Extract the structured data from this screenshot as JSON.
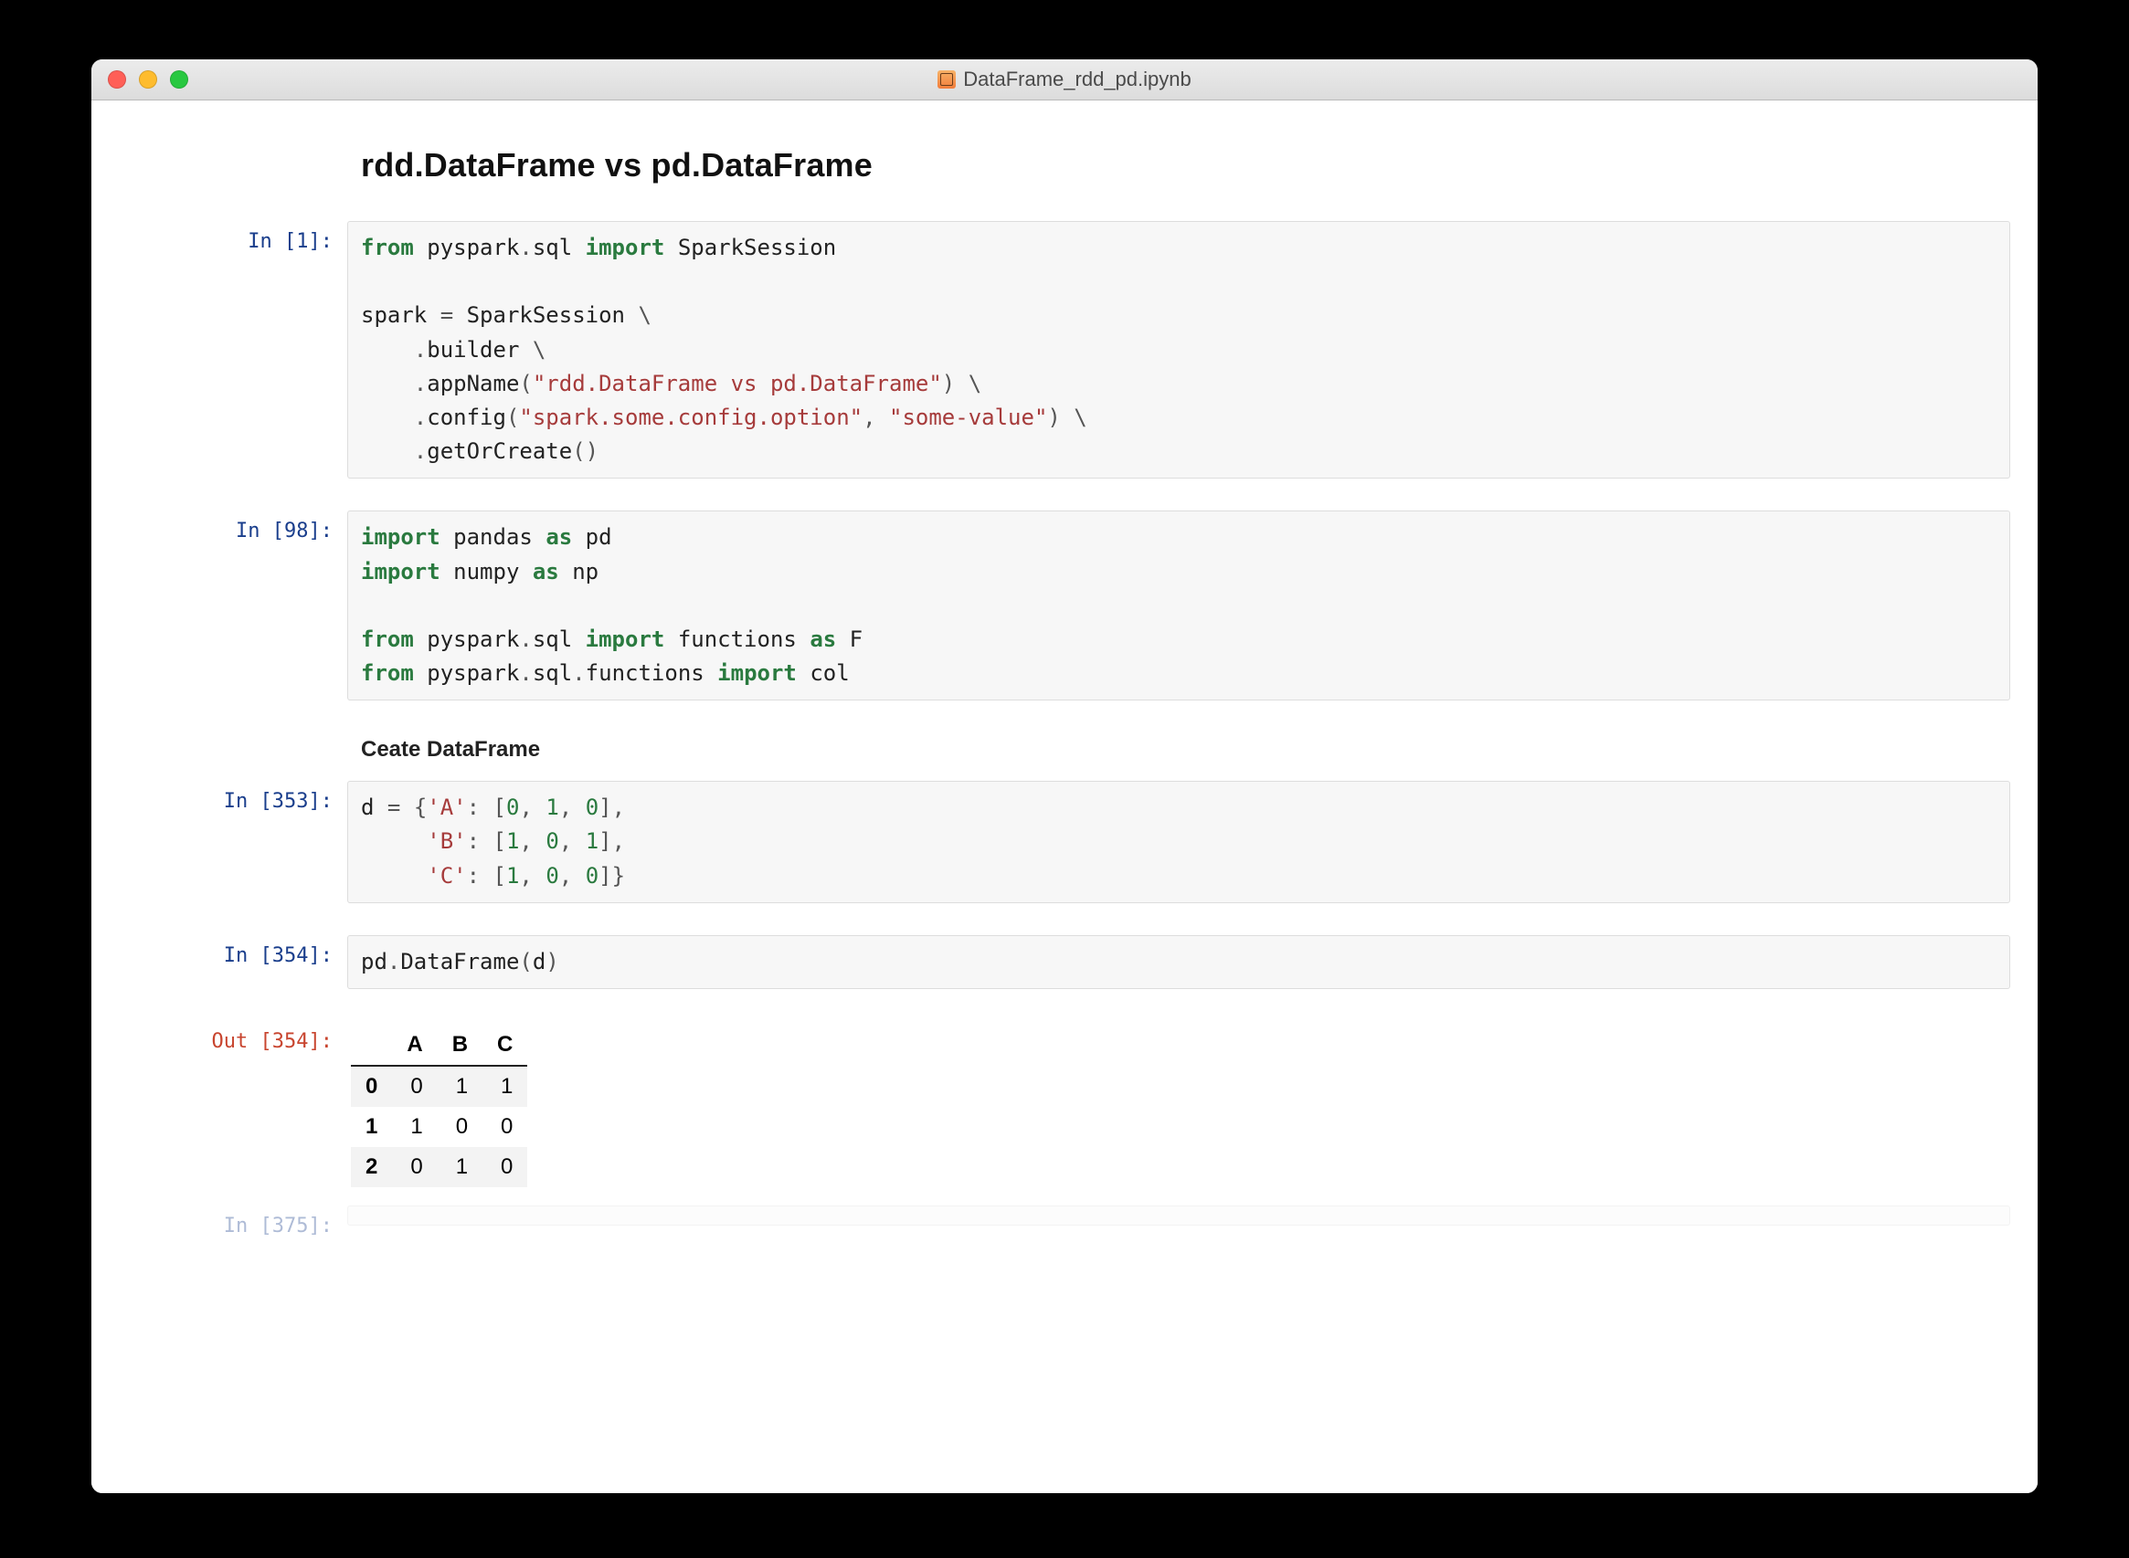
{
  "window": {
    "title": "DataFrame_rdd_pd.ipynb"
  },
  "heading": "rdd.DataFrame vs pd.DataFrame",
  "subheading": "Ceate DataFrame",
  "prompts": {
    "in1": "In [1]:",
    "in98": "In [98]:",
    "in353": "In [353]:",
    "in354": "In [354]:",
    "out354": "Out [354]:",
    "in375": "In [375]:"
  },
  "cells": {
    "c1": {
      "tokens": [
        {
          "t": "from ",
          "c": "kw"
        },
        {
          "t": "pyspark",
          "c": "nm"
        },
        {
          "t": ".",
          "c": "pun"
        },
        {
          "t": "sql ",
          "c": "nm"
        },
        {
          "t": "import ",
          "c": "kw"
        },
        {
          "t": "SparkSession",
          "c": "nm"
        },
        {
          "t": "\n\n"
        },
        {
          "t": "spark ",
          "c": "nm"
        },
        {
          "t": "= ",
          "c": "pun"
        },
        {
          "t": "SparkSession ",
          "c": "nm"
        },
        {
          "t": "\\",
          "c": "pun"
        },
        {
          "t": "\n"
        },
        {
          "t": "    .",
          "c": "pun"
        },
        {
          "t": "builder ",
          "c": "nm"
        },
        {
          "t": "\\",
          "c": "pun"
        },
        {
          "t": "\n"
        },
        {
          "t": "    .",
          "c": "pun"
        },
        {
          "t": "appName",
          "c": "nm"
        },
        {
          "t": "(",
          "c": "pun"
        },
        {
          "t": "\"rdd.DataFrame vs pd.DataFrame\"",
          "c": "str"
        },
        {
          "t": ") ",
          "c": "pun"
        },
        {
          "t": "\\",
          "c": "pun"
        },
        {
          "t": "\n"
        },
        {
          "t": "    .",
          "c": "pun"
        },
        {
          "t": "config",
          "c": "nm"
        },
        {
          "t": "(",
          "c": "pun"
        },
        {
          "t": "\"spark.some.config.option\"",
          "c": "str"
        },
        {
          "t": ", ",
          "c": "pun"
        },
        {
          "t": "\"some-value\"",
          "c": "str"
        },
        {
          "t": ") ",
          "c": "pun"
        },
        {
          "t": "\\",
          "c": "pun"
        },
        {
          "t": "\n"
        },
        {
          "t": "    .",
          "c": "pun"
        },
        {
          "t": "getOrCreate",
          "c": "nm"
        },
        {
          "t": "()",
          "c": "pun"
        }
      ]
    },
    "c98": {
      "tokens": [
        {
          "t": "import ",
          "c": "kw"
        },
        {
          "t": "pandas ",
          "c": "nm"
        },
        {
          "t": "as ",
          "c": "kw"
        },
        {
          "t": "pd",
          "c": "nm"
        },
        {
          "t": "\n"
        },
        {
          "t": "import ",
          "c": "kw"
        },
        {
          "t": "numpy ",
          "c": "nm"
        },
        {
          "t": "as ",
          "c": "kw"
        },
        {
          "t": "np",
          "c": "nm"
        },
        {
          "t": "\n\n"
        },
        {
          "t": "from ",
          "c": "kw"
        },
        {
          "t": "pyspark",
          "c": "nm"
        },
        {
          "t": ".",
          "c": "pun"
        },
        {
          "t": "sql ",
          "c": "nm"
        },
        {
          "t": "import ",
          "c": "kw"
        },
        {
          "t": "functions ",
          "c": "nm"
        },
        {
          "t": "as ",
          "c": "kw"
        },
        {
          "t": "F",
          "c": "nm"
        },
        {
          "t": "\n"
        },
        {
          "t": "from ",
          "c": "kw"
        },
        {
          "t": "pyspark",
          "c": "nm"
        },
        {
          "t": ".",
          "c": "pun"
        },
        {
          "t": "sql",
          "c": "nm"
        },
        {
          "t": ".",
          "c": "pun"
        },
        {
          "t": "functions ",
          "c": "nm"
        },
        {
          "t": "import ",
          "c": "kw"
        },
        {
          "t": "col",
          "c": "nm"
        }
      ]
    },
    "c353": {
      "tokens": [
        {
          "t": "d ",
          "c": "nm"
        },
        {
          "t": "= ",
          "c": "pun"
        },
        {
          "t": "{",
          "c": "pun"
        },
        {
          "t": "'A'",
          "c": "str"
        },
        {
          "t": ": [",
          "c": "pun"
        },
        {
          "t": "0",
          "c": "num"
        },
        {
          "t": ", ",
          "c": "pun"
        },
        {
          "t": "1",
          "c": "num"
        },
        {
          "t": ", ",
          "c": "pun"
        },
        {
          "t": "0",
          "c": "num"
        },
        {
          "t": "],",
          "c": "pun"
        },
        {
          "t": "\n"
        },
        {
          "t": "     ",
          "c": "nm"
        },
        {
          "t": "'B'",
          "c": "str"
        },
        {
          "t": ": [",
          "c": "pun"
        },
        {
          "t": "1",
          "c": "num"
        },
        {
          "t": ", ",
          "c": "pun"
        },
        {
          "t": "0",
          "c": "num"
        },
        {
          "t": ", ",
          "c": "pun"
        },
        {
          "t": "1",
          "c": "num"
        },
        {
          "t": "],",
          "c": "pun"
        },
        {
          "t": "\n"
        },
        {
          "t": "     ",
          "c": "nm"
        },
        {
          "t": "'C'",
          "c": "str"
        },
        {
          "t": ": [",
          "c": "pun"
        },
        {
          "t": "1",
          "c": "num"
        },
        {
          "t": ", ",
          "c": "pun"
        },
        {
          "t": "0",
          "c": "num"
        },
        {
          "t": ", ",
          "c": "pun"
        },
        {
          "t": "0",
          "c": "num"
        },
        {
          "t": "]}",
          "c": "pun"
        }
      ]
    },
    "c354": {
      "tokens": [
        {
          "t": "pd",
          "c": "nm"
        },
        {
          "t": ".",
          "c": "pun"
        },
        {
          "t": "DataFrame",
          "c": "nm"
        },
        {
          "t": "(",
          "c": "pun"
        },
        {
          "t": "d",
          "c": "nm"
        },
        {
          "t": ")",
          "c": "pun"
        }
      ]
    }
  },
  "dataframe": {
    "columns": [
      "A",
      "B",
      "C"
    ],
    "index": [
      "0",
      "1",
      "2"
    ],
    "rows": [
      [
        "0",
        "1",
        "1"
      ],
      [
        "1",
        "0",
        "0"
      ],
      [
        "0",
        "1",
        "0"
      ]
    ]
  }
}
